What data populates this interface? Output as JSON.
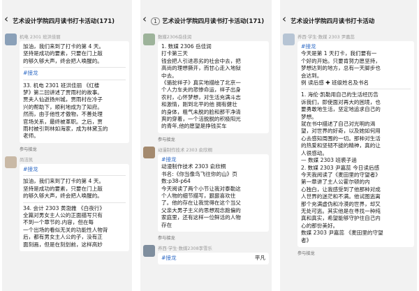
{
  "colors": {
    "tag": "#2a67c4",
    "background": "#f2f2f2",
    "bubble": "#ffffff"
  },
  "phone1": {
    "title": "艺术设计学院四月读书打卡活动(171)",
    "msg1": {
      "sender": "机电 2301 班洪佳丽",
      "lines": [
        "加油，我们来到了打卡的第 4 天。",
        "坚持是成功的要素，只要在门上敲",
        "的够久够大声，终会把人唤醒的。"
      ],
      "hashtag": "#接龙",
      "entry": [
        "33. 机电 2301 班洪佳丽 《红楼",
        "梦》第二回讲述了贾雨村的故事。",
        "贾夫人仙逝扬州城，贾雨村在冷子",
        "兴的帮助下，顺利地成为了知府。",
        "然而，由于他性才傲物，不善处理",
        "官场关系，最终被革职。之后，贾",
        "雨村被引到林如海家，成为林黛玉的",
        "老师。"
      ],
      "quote": "参与接龙"
    },
    "msg2": {
      "sender": "尚洁凯",
      "hashtag": "#接龙",
      "lines": [
        "加油，我们来到了打卡的第 4 天。",
        "坚持是成功的要素，只要在门上敲",
        "的够久够大声，终会把人唤醒的。"
      ],
      "entry": [
        "34. 会计 2303 黄渤雅 《白夜行》",
        "全篇对男女主人公的正面描写只有",
        "不到一个章节的.内容，但在每",
        "一个出场的看似无关的功能性人物背",
        "后，都有男女主人公的子，没有正",
        "面刻画，但是在刻划前，这样高妙"
      ]
    }
  },
  "phone2": {
    "badge": "1",
    "title": "艺术设计学院四月读书打卡活动(171)",
    "msg1": {
      "sender": "数媒2306岳佳润",
      "lines": [
        "1. 数媒 2306 岳佳润",
        "打卡第三天",
        "钱会把人引进恶劣的社会中去，把",
        "高尚的理想撕开，而甘心走入地狱",
        "中去。"
      ],
      "entry": [
        "《骆驼祥子》真实地描绘了北京一",
        "个人力车夫的悲惨命运，祥子出身",
        "农村，心怀梦想，对生活充满斗志",
        "和激情，刚到北平的他 拥有健壮",
        "的身体，粗气未脱的脸和那干净清",
        "爽的穿着，一个活脱脱的积极阳光",
        "的青年,他的愿望是挣钱买车"
      ],
      "quote": "参与接龙"
    },
    "msg2": {
      "sender": "动漫制作技术 2303 俞欣桐",
      "hashtag": "#接龙",
      "lines": [
        "动漫制作技术 2303  俞欣桐",
        "书名:《你当像鸟飞往你的山》页",
        "数:p38-p64"
      ],
      "entry": [
        "今天阅读了两个小节让我对泰勒这",
        "个人物的细节描写，狠狠喜欢住",
        "了。他的存在让我觉得在这个当父",
        "父亲大男子主义的思想观念跑偏的",
        "家庭里，还有这样一位鲜活的人物",
        "存在"
      ],
      "quote": "参与接龙"
    },
    "msg3": {
      "sender": "养西·学生·数媒2308李雪乐",
      "hashtag": "#接龙",
      "trailing": "平凡"
    }
  },
  "phone3": {
    "title": "艺术设计学院四月读书打卡活动",
    "msg1": {
      "sender": "养西·学生·数媒 2303 尹嘉蕊",
      "hashtag": "#接龙",
      "lines": [
        "今天是第 1 天打卡，我们要有一",
        "个好的开始。只要肯努力愿坚持，",
        "梦想达到的地方，总有一天脚步也",
        "会达到。",
        "例 读后感 ✚ 班级姓名及书名"
      ],
      "entry": [
        "1. 海伦·凯勒用自己的生活经历告",
        "诉我们，即使面对再大的困境，也",
        "要勇敢地生活，坚定地追求自己的",
        "梦想。",
        "    就在书中描述了自己对光明的渴",
        "望，对世界的好奇，以及她如何用",
        "心去感知周围的一切。那种对生活",
        "的热爱和坚韧不拔的精神，真的让",
        "人很感动。",
        "— 数媒 2303 班裘子涵",
        "2. 数媒 2303 尹嘉蕊  今日读后感",
        "今天我阅读了《麦田里的守望者》",
        "第一章讲了主人公霍尔顿的内",
        "心独白，让我感受到了他那种对成",
        "人世界的迷茫和不满。他试图逃离",
        "那个充满虚伪和冷漠的世界，却又",
        "无处可逃。其实他是在寻找一种纯",
        "真和真实，希望能够守护住自己内",
        "心的那份美好。",
        "数媒 2303 尹嘉蕊 《麦田里的守望",
        "者》"
      ],
      "quote": "参与接龙"
    }
  }
}
